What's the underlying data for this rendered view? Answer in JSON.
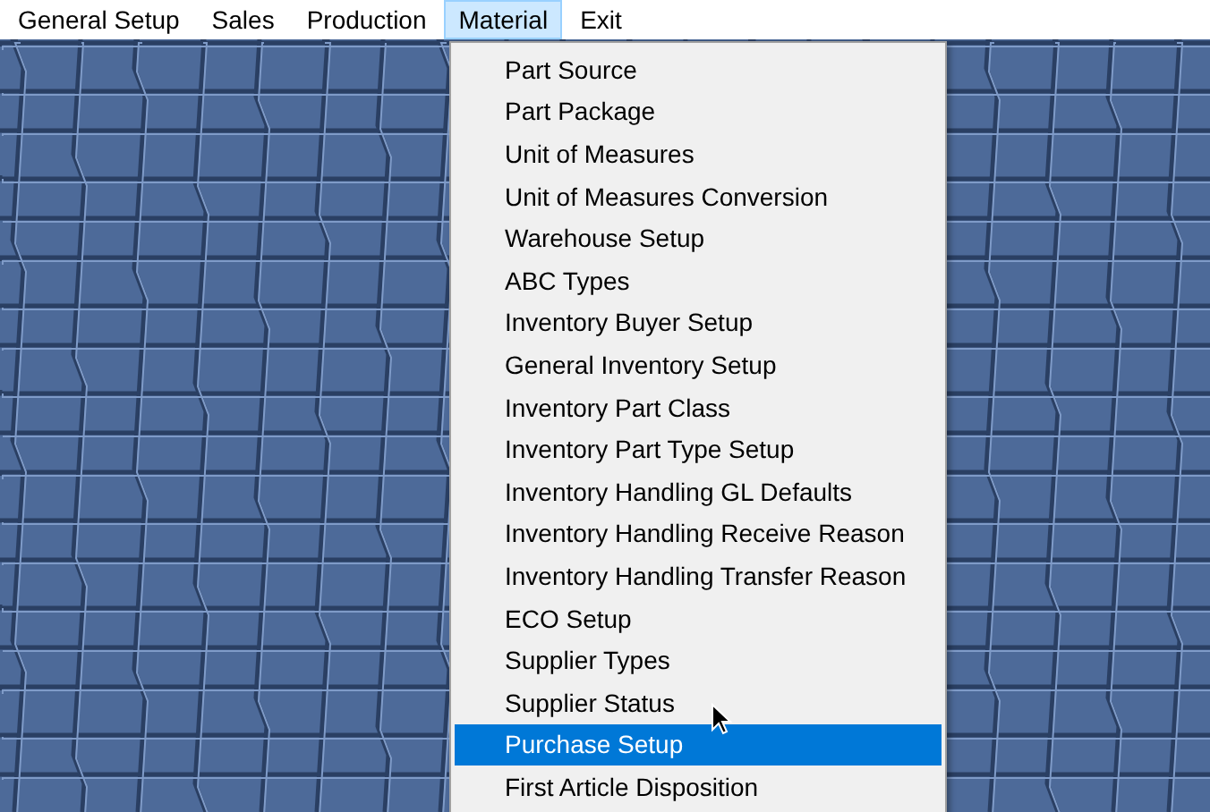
{
  "menu_bar": [
    {
      "label": "General Setup",
      "selected": false
    },
    {
      "label": "Sales",
      "selected": false
    },
    {
      "label": "Production",
      "selected": false
    },
    {
      "label": "Material",
      "selected": true
    },
    {
      "label": "Exit",
      "selected": false
    }
  ],
  "dropdown": {
    "items": [
      {
        "label": "Part Source",
        "selected": false
      },
      {
        "label": "Part Package",
        "selected": false
      },
      {
        "label": "Unit of Measures",
        "selected": false
      },
      {
        "label": "Unit of Measures Conversion",
        "selected": false
      },
      {
        "label": "Warehouse Setup",
        "selected": false
      },
      {
        "label": "ABC Types",
        "selected": false
      },
      {
        "label": "Inventory Buyer Setup",
        "selected": false
      },
      {
        "label": "General Inventory Setup",
        "selected": false
      },
      {
        "label": "Inventory Part Class",
        "selected": false
      },
      {
        "label": "Inventory Part Type Setup",
        "selected": false
      },
      {
        "label": "Inventory Handling GL Defaults",
        "selected": false
      },
      {
        "label": "Inventory Handling Receive Reason",
        "selected": false
      },
      {
        "label": "Inventory Handling Transfer Reason",
        "selected": false
      },
      {
        "label": "ECO Setup",
        "selected": false
      },
      {
        "label": "Supplier Types",
        "selected": false
      },
      {
        "label": "Supplier Status",
        "selected": false
      },
      {
        "label": "Purchase Setup",
        "selected": true
      },
      {
        "label": "First Article Disposition",
        "selected": false
      }
    ]
  }
}
